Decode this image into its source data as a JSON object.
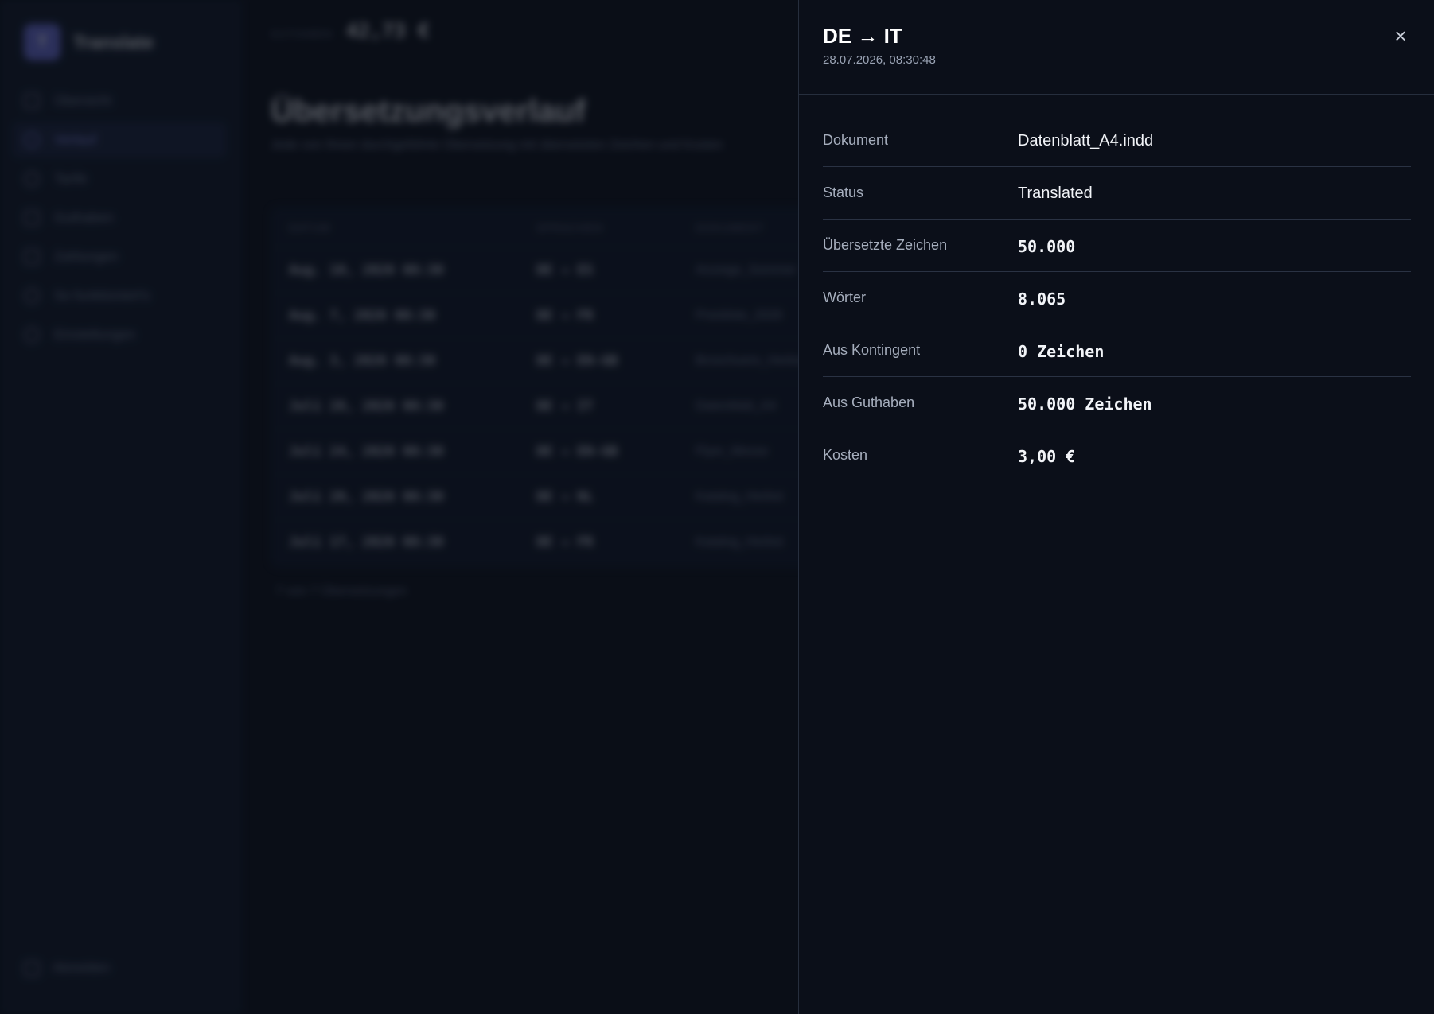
{
  "app": {
    "logo_letter": "T",
    "name": "Translate",
    "nav": [
      {
        "label": "Übersicht",
        "active": false
      },
      {
        "label": "Verlauf",
        "active": true
      },
      {
        "label": "Tarife",
        "active": false
      },
      {
        "label": "Guthaben",
        "active": false
      },
      {
        "label": "Zahlungen",
        "active": false
      },
      {
        "label": "So funktioniert's",
        "active": false
      },
      {
        "label": "Einstellungen",
        "active": false
      }
    ],
    "logout_label": "Abmelden",
    "accent_color": "#6a6fd8"
  },
  "header": {
    "balance_label": "GUTHABEN",
    "balance_value": "42,73 €"
  },
  "page": {
    "title": "Übersetzungsverlauf",
    "subtitle": "Jede von Ihnen durchgeführte Übersetzung mit übersetzten Zeichen und Kosten"
  },
  "table": {
    "columns": [
      "DATUM",
      "SPRACHEN",
      "DOKUMENT"
    ],
    "rows": [
      {
        "date": "Aug. 10, 2026 08:30",
        "langs": "DE → ES",
        "doc": "Anzeige_Sommer"
      },
      {
        "date": "Aug. 7, 2026 08:30",
        "langs": "DE → FR",
        "doc": "Preisliste_2026"
      },
      {
        "date": "Aug. 3, 2026 08:30",
        "langs": "DE → EN-GB",
        "doc": "Broschuere_Herbst"
      },
      {
        "date": "Juli 28, 2026 08:30",
        "langs": "DE → IT",
        "doc": "Datenblatt_A4"
      },
      {
        "date": "Juli 24, 2026 08:30",
        "langs": "DE → EN-GB",
        "doc": "Flyer_Messe"
      },
      {
        "date": "Juli 20, 2026 08:30",
        "langs": "DE → NL",
        "doc": "Katalog_Herbst"
      },
      {
        "date": "Juli 17, 2026 08:30",
        "langs": "DE → FR",
        "doc": "Katalog_Herbst"
      }
    ],
    "count_text": "7 von 7 Übersetzungen"
  },
  "drawer": {
    "title": "DE → IT",
    "timestamp": "28.07.2026, 08:30:48",
    "close_glyph": "×",
    "details": [
      {
        "label": "Dokument",
        "value": "Datenblatt_A4.indd",
        "mono": false
      },
      {
        "label": "Status",
        "value": "Translated",
        "mono": false
      },
      {
        "label": "Übersetzte Zeichen",
        "value": "50.000",
        "mono": true
      },
      {
        "label": "Wörter",
        "value": "8.065",
        "mono": true
      },
      {
        "label": "Aus Kontingent",
        "value": "0 Zeichen",
        "mono": true
      },
      {
        "label": "Aus Guthaben",
        "value": "50.000 Zeichen",
        "mono": true
      },
      {
        "label": "Kosten",
        "value": "3,00 €",
        "mono": true
      }
    ]
  }
}
